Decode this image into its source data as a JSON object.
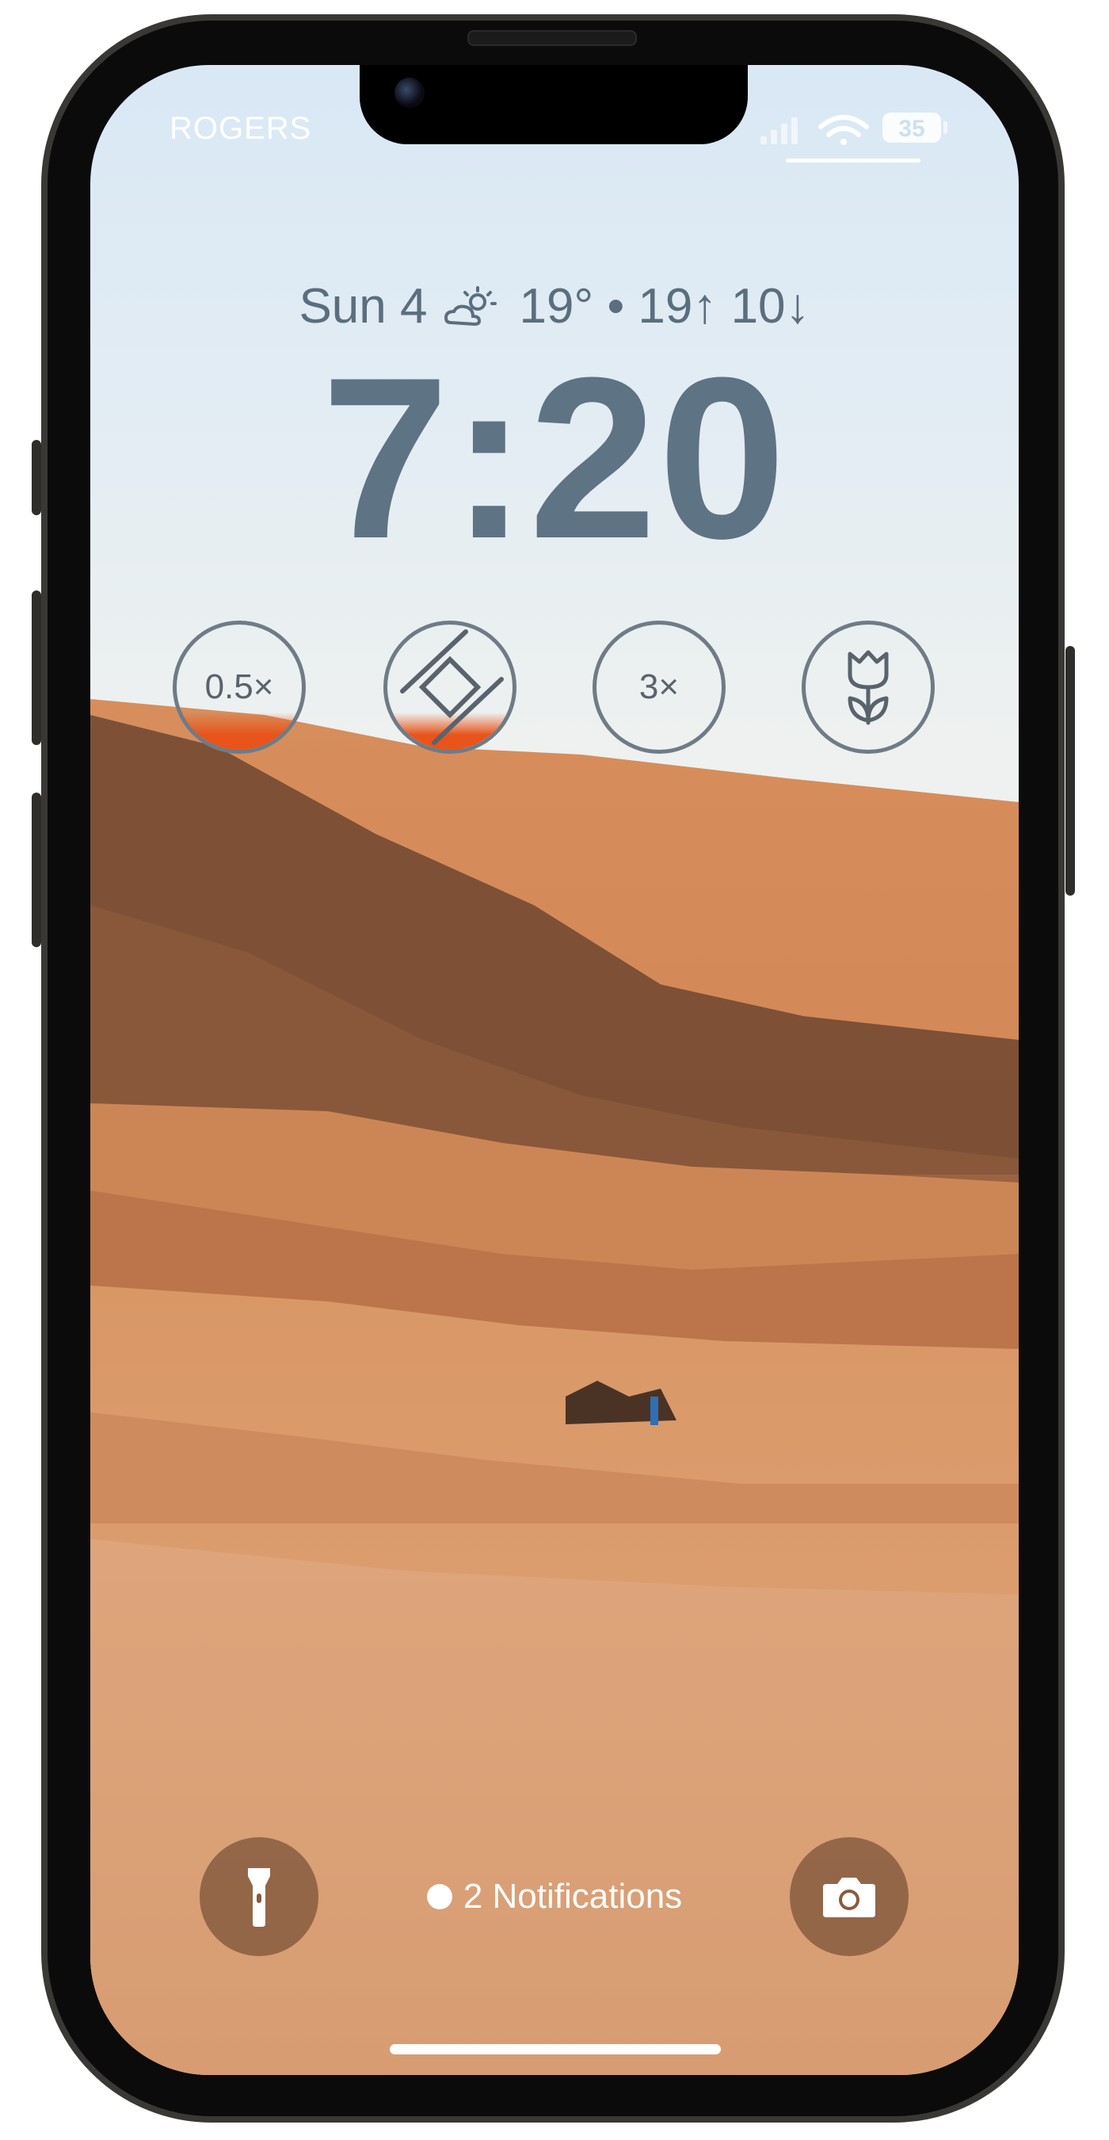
{
  "status_bar": {
    "carrier": "ROGERS",
    "battery_level": "35",
    "signal_icon": "cellular-signal-icon",
    "wifi_icon": "wifi-icon"
  },
  "lock_screen": {
    "date": "Sun 4",
    "weather_icon": "partly-sunny-icon",
    "weather_text": "19° • 19↑ 10↓",
    "time": "7:20"
  },
  "widgets": [
    {
      "id": "zoom-05",
      "label": "0.5×",
      "progress": 0.3
    },
    {
      "id": "camera-zoom-widget",
      "icon": "crop-rotate-icon",
      "progress": 0.3
    },
    {
      "id": "zoom-3",
      "label": "3×",
      "progress": 0
    },
    {
      "id": "macro",
      "icon": "tulip-icon",
      "progress": 0
    }
  ],
  "bottom_controls": {
    "flashlight_icon": "flashlight-icon",
    "notifications_label": "2 Notifications",
    "camera_icon": "camera-icon"
  },
  "colors": {
    "widget_accent": "#e8541a",
    "clock": "#5e7384"
  }
}
